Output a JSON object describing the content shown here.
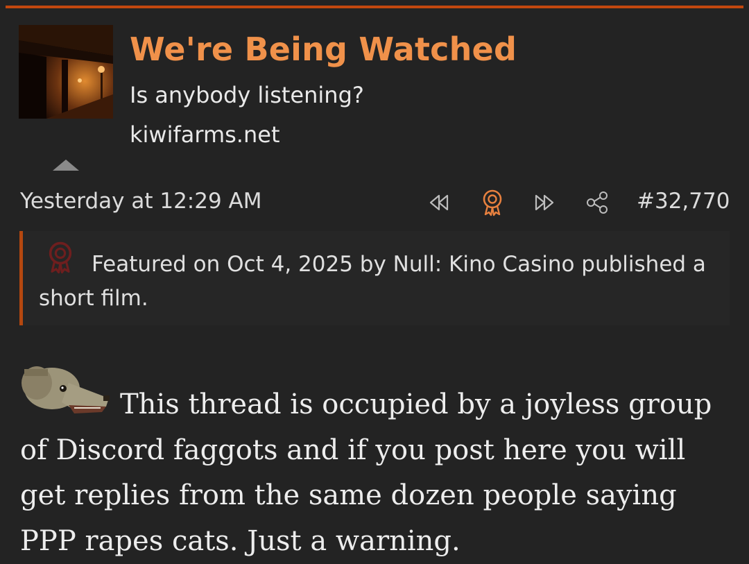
{
  "user": {
    "name": "We're Being Watched",
    "title": "Is anybody listening?",
    "site": "kiwifarms.net",
    "avatar_icon": "avatar-night-bridge-image"
  },
  "post": {
    "date": "Yesterday at 12:29 AM",
    "number": "#32,770",
    "actions": [
      "first-icon",
      "featured-ribbon-icon",
      "last-icon",
      "share-icon"
    ],
    "accent_color": "#f0914a"
  },
  "featured": {
    "text": "Featured on Oct 4, 2025 by Null: Kino Casino published a short film."
  },
  "body": {
    "text": "This thread is occupied by a joyless group of Discord faggots and if you post here you will get replies from the same dozen people saying PPP rapes cats. Just a warning.",
    "emoji": "pixel-dog-emoji"
  }
}
